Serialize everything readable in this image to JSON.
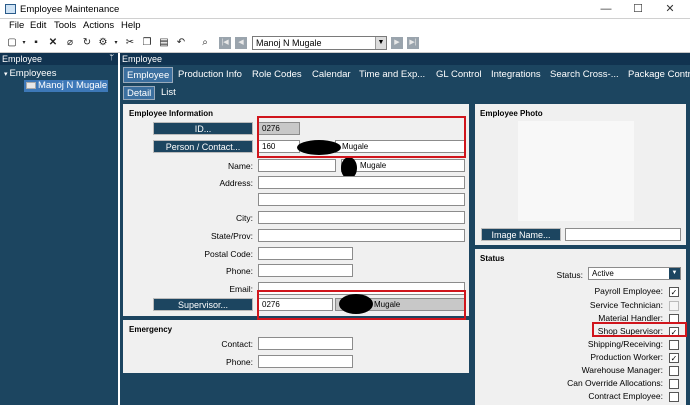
{
  "window": {
    "title": "Employee Maintenance",
    "minimize": "—",
    "maximize": "☐",
    "close": "✕"
  },
  "menu": [
    "File",
    "Edit",
    "Tools",
    "Actions",
    "Help"
  ],
  "toolbar": {
    "employee_select": "Manoj N Mugale"
  },
  "left_panel": {
    "header": "Employee",
    "pin": "ᛘ",
    "tree_root": "Employees",
    "tree_child": "Manoj N Mugale"
  },
  "right_panel": {
    "header": "Employee"
  },
  "tabs": [
    "Employee",
    "Production Info",
    "Role Codes",
    "Calendar",
    "Time and Exp...",
    "GL Control",
    "Integrations",
    "Search  Cross-...",
    "Package Contr"
  ],
  "subtabs": [
    "Detail",
    "List"
  ],
  "info": {
    "heading": "Employee Information",
    "id_button": "ID...",
    "id_value": "0276",
    "person_button": "Person / Contact...",
    "person_id": "160",
    "person_name": "Mugale",
    "name_label": "Name:",
    "last_name": "Mugale",
    "address_label": "Address:",
    "city_label": "City:",
    "state_label": "State/Prov:",
    "postal_label": "Postal Code:",
    "phone_label": "Phone:",
    "email_label": "Email:",
    "supervisor_button": "Supervisor...",
    "supervisor_id": "0276",
    "supervisor_name": "Mugale"
  },
  "emergency": {
    "heading": "Emergency",
    "contact_label": "Contact:",
    "phone_label": "Phone:"
  },
  "photo": {
    "heading": "Employee Photo",
    "image_button": "Image Name..."
  },
  "status": {
    "heading": "Status",
    "status_label": "Status:",
    "status_value": "Active",
    "checks": [
      {
        "label": "Payroll Employee:",
        "checked": true,
        "disabled": false
      },
      {
        "label": "Service Technician:",
        "checked": false,
        "disabled": true
      },
      {
        "label": "Material Handler:",
        "checked": false,
        "disabled": false
      },
      {
        "label": "Shop Supervisor:",
        "checked": true,
        "disabled": false
      },
      {
        "label": "Shipping/Receiving:",
        "checked": false,
        "disabled": false
      },
      {
        "label": "Production Worker:",
        "checked": true,
        "disabled": false
      },
      {
        "label": "Warehouse Manager:",
        "checked": false,
        "disabled": false
      },
      {
        "label": "Can Override Allocations:",
        "checked": false,
        "disabled": false
      },
      {
        "label": "Contract Employee:",
        "checked": false,
        "disabled": false
      }
    ]
  },
  "colors": {
    "accent": "#1c4560",
    "highlight": "#d0151c",
    "tree_selected": "#3d78b8"
  }
}
